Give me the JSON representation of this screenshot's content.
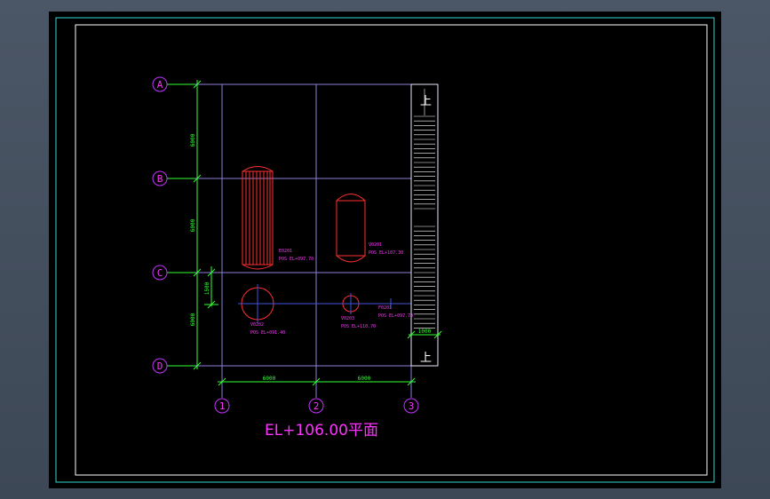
{
  "colors": {
    "background_outer": "#47525f",
    "sheet": "#000000",
    "border_cyan": "#38d6d6",
    "border_white": "#ffffff",
    "grid_magenta": "#c233ff",
    "grid_line": "#8f7fd8",
    "dimension_green": "#33ff33",
    "equipment_red": "#ff3030",
    "label_magenta": "#ff33ff",
    "stair_white": "#ffffff",
    "centerline_blue": "#4055d8"
  },
  "axes": {
    "rows": [
      "A",
      "B",
      "C",
      "D"
    ],
    "columns": [
      "1",
      "2",
      "3"
    ]
  },
  "dimensions": {
    "row_spacing": [
      "6000",
      "6000",
      "6000"
    ],
    "column_spacing": [
      "6000",
      "6000"
    ],
    "small_offset": "1500",
    "stair_width": "1000"
  },
  "equipment": {
    "vessel_1": {
      "tag": "E0201",
      "elevation": "POS EL+097.70"
    },
    "vessel_2": {
      "tag": "V0201",
      "elevation": "POS EL+107.30"
    },
    "vessel_3": {
      "tag": "V0202",
      "elevation": "POS EL+091.40"
    },
    "vessel_4": {
      "tag": "V0203",
      "elevation": "POS EL+110.70"
    },
    "vessel_5": {
      "tag": "F0201",
      "elevation": "POS EL+097.70"
    }
  },
  "stair": {
    "up_label_top": "上",
    "up_label_bottom": "上"
  },
  "title": "EL+106.00平面"
}
